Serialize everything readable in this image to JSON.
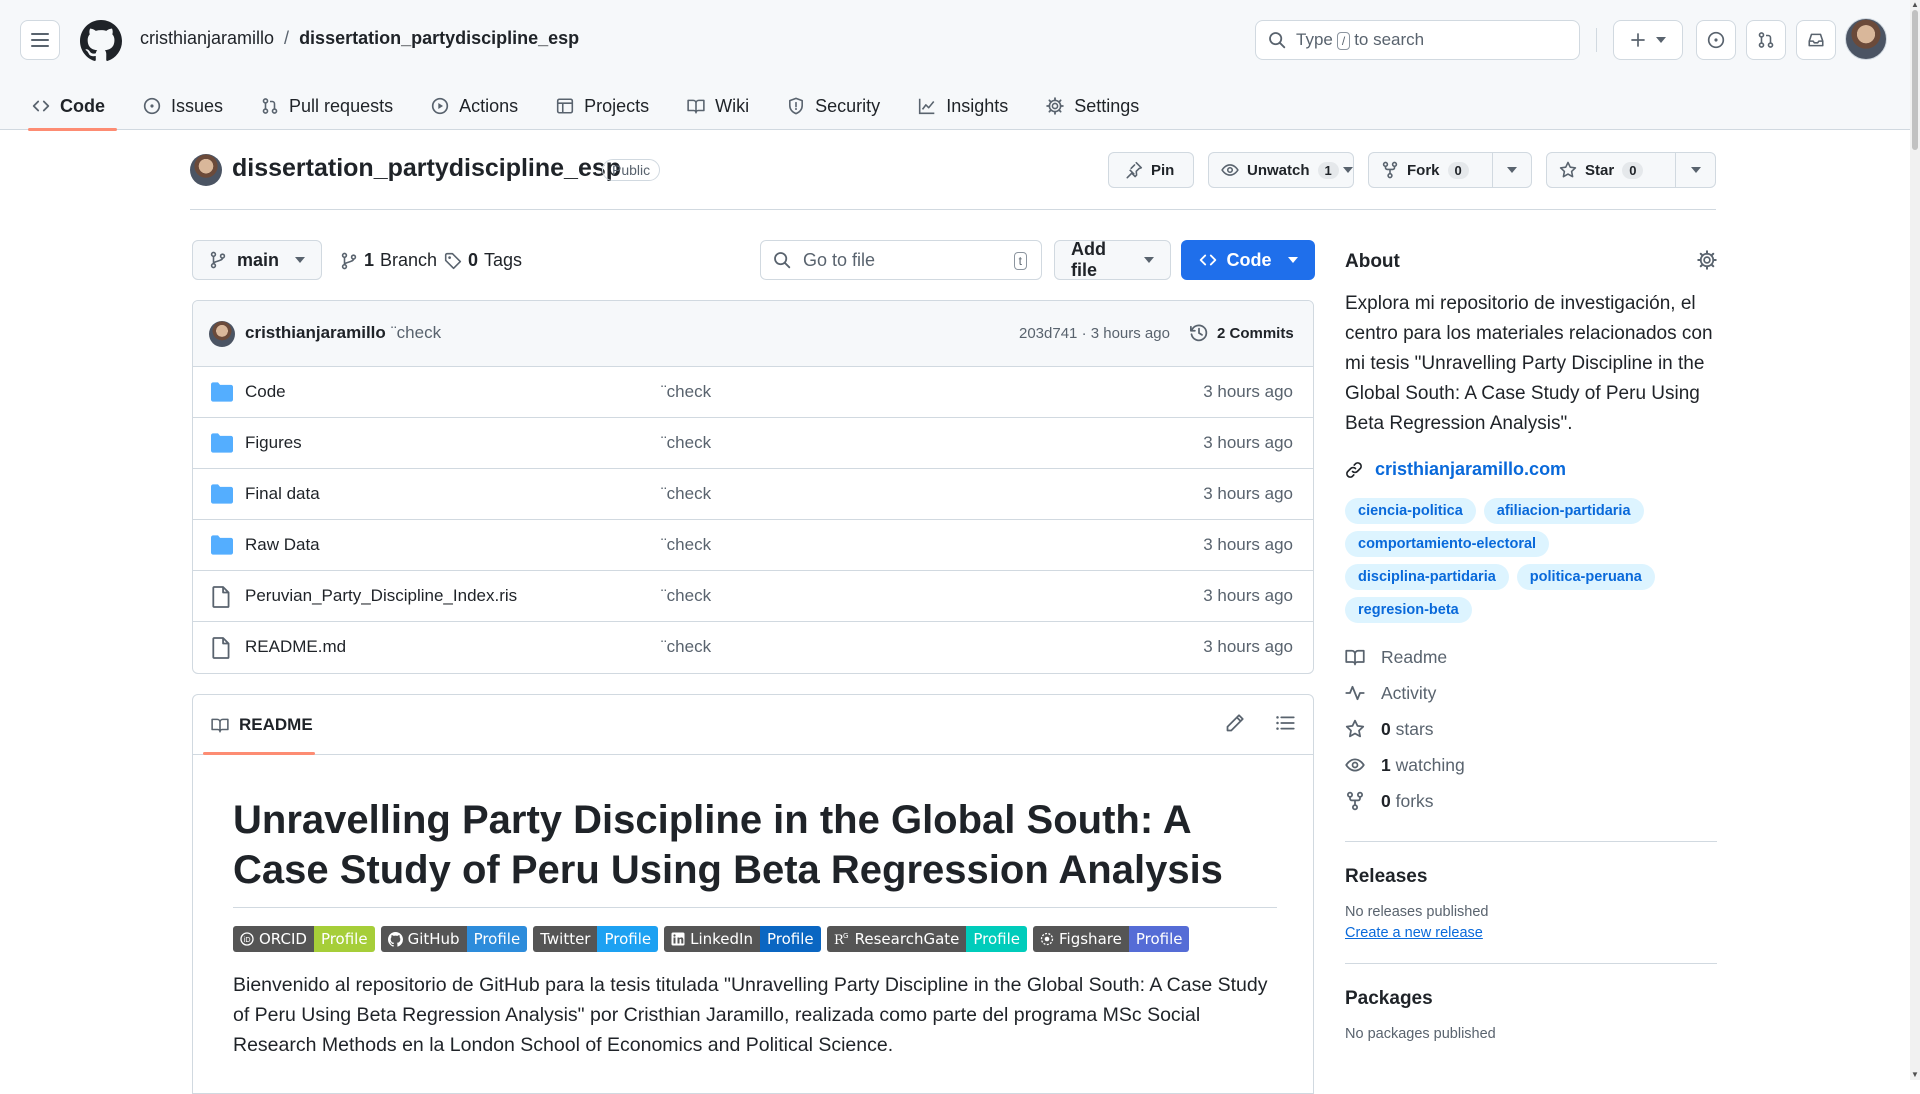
{
  "header": {
    "owner": "cristhianjaramillo",
    "separator": "/",
    "repo": "dissertation_partydiscipline_esp",
    "search_prefix": "Type",
    "search_key": "/",
    "search_suffix": "to search"
  },
  "tabs": [
    {
      "label": "Code",
      "icon": "code-icon"
    },
    {
      "label": "Issues",
      "icon": "issue-icon"
    },
    {
      "label": "Pull requests",
      "icon": "pull-request-icon"
    },
    {
      "label": "Actions",
      "icon": "play-icon"
    },
    {
      "label": "Projects",
      "icon": "table-icon"
    },
    {
      "label": "Wiki",
      "icon": "book-icon"
    },
    {
      "label": "Security",
      "icon": "shield-icon"
    },
    {
      "label": "Insights",
      "icon": "graph-icon"
    },
    {
      "label": "Settings",
      "icon": "gear-icon"
    }
  ],
  "repo_head": {
    "name": "dissertation_partydiscipline_esp",
    "visibility": "Public",
    "pin_label": "Pin",
    "unwatch_label": "Unwatch",
    "watch_count": "1",
    "fork_label": "Fork",
    "fork_count": "0",
    "star_label": "Star",
    "star_count": "0"
  },
  "file_nav": {
    "branch": "main",
    "branches_count": "1",
    "branches_label": "Branch",
    "tags_count": "0",
    "tags_label": "Tags",
    "goto_placeholder": "Go to file",
    "goto_key": "t",
    "add_file_label": "Add file",
    "code_label": "Code"
  },
  "latest_commit": {
    "author": "cristhianjaramillo",
    "message": "¨check",
    "hash_time": "203d741 · 3 hours ago",
    "commits_label": "2 Commits"
  },
  "files": [
    {
      "name": "Code",
      "type": "folder",
      "message": "¨check",
      "time": "3 hours ago"
    },
    {
      "name": "Figures",
      "type": "folder",
      "message": "¨check",
      "time": "3 hours ago"
    },
    {
      "name": "Final data",
      "type": "folder",
      "message": "¨check",
      "time": "3 hours ago"
    },
    {
      "name": "Raw Data",
      "type": "folder",
      "message": "¨check",
      "time": "3 hours ago"
    },
    {
      "name": "Peruvian_Party_Discipline_Index.ris",
      "type": "file",
      "message": "¨check",
      "time": "3 hours ago"
    },
    {
      "name": "README.md",
      "type": "file",
      "message": "¨check",
      "time": "3 hours ago"
    }
  ],
  "readme": {
    "tab_label": "README",
    "title": "Unravelling Party Discipline in the Global South: A Case Study of Peru Using Beta Regression Analysis",
    "badges": [
      {
        "name": "ORCID",
        "value": "Profile",
        "color": "#a6ce39"
      },
      {
        "name": "GitHub",
        "value": "Profile",
        "color": "#2d8cdb"
      },
      {
        "name": "Twitter",
        "value": "Profile",
        "color": "#1da1f2"
      },
      {
        "name": "LinkedIn",
        "value": "Profile",
        "color": "#0a66c2"
      },
      {
        "name": "ResearchGate",
        "value": "Profile",
        "color": "#00ccbb"
      },
      {
        "name": "Figshare",
        "value": "Profile",
        "color": "#556cd6"
      }
    ],
    "intro": "Bienvenido al repositorio de GitHub para la tesis titulada \"Unravelling Party Discipline in the Global South: A Case Study of Peru Using Beta Regression Analysis\" por Cristhian Jaramillo, realizada como parte del programa MSc Social Research Methods en la London School of Economics and Political Science."
  },
  "about": {
    "heading": "About",
    "description": "Explora mi repositorio de investigación, el centro para los materiales relacionados con mi tesis \"Unravelling Party Discipline in the Global South: A Case Study of Peru Using Beta Regression Analysis\".",
    "website": "cristhianjaramillo.com",
    "topics": [
      "ciencia-politica",
      "afiliacion-partidaria",
      "comportamiento-electoral",
      "disciplina-partidaria",
      "politica-peruana",
      "regresion-beta"
    ],
    "readme_label": "Readme",
    "activity_label": "Activity",
    "stars_count": "0",
    "stars_label": "stars",
    "watching_count": "1",
    "watching_label": "watching",
    "forks_count": "0",
    "forks_label": "forks",
    "releases_heading": "Releases",
    "no_releases": "No releases published",
    "create_release": "Create a new release",
    "packages_heading": "Packages",
    "no_packages": "No packages published"
  },
  "colors": {
    "accent": "#1f6feb",
    "link": "#0969da",
    "tab_underline": "#fd8c73",
    "folder": "#54aeff"
  }
}
